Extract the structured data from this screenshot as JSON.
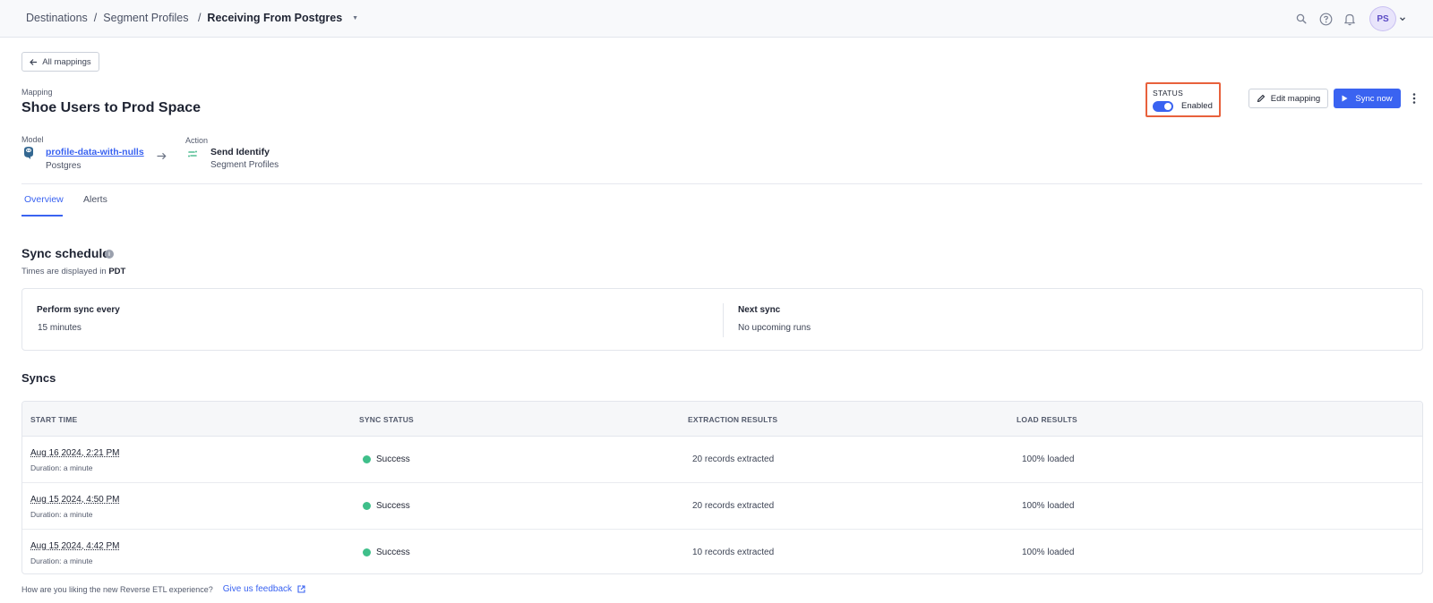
{
  "breadcrumbs": {
    "item1": "Destinations",
    "item2": "Segment Profiles",
    "current": "Receiving From Postgres"
  },
  "user": {
    "initials": "PS"
  },
  "back_button": "All mappings",
  "mapping": {
    "label": "Mapping",
    "title": "Shoe Users to Prod Space"
  },
  "status": {
    "label": "STATUS",
    "toggle_text": "Enabled",
    "enabled": true
  },
  "actions": {
    "edit": "Edit mapping",
    "sync": "Sync now"
  },
  "model": {
    "label": "Model",
    "name": "profile-data-with-nulls",
    "source": "Postgres"
  },
  "action": {
    "label": "Action",
    "name": "Send Identify",
    "destination": "Segment Profiles"
  },
  "tabs": {
    "overview": "Overview",
    "alerts": "Alerts"
  },
  "schedule": {
    "title": "Sync schedule",
    "tz_prefix": "Times are displayed in",
    "tz": "PDT",
    "perform_label": "Perform sync every",
    "perform_value": "15 minutes",
    "next_label": "Next sync",
    "next_value": "No upcoming runs"
  },
  "syncs": {
    "title": "Syncs",
    "columns": {
      "start": "START TIME",
      "status": "SYNC STATUS",
      "extraction": "EXTRACTION RESULTS",
      "load": "LOAD RESULTS"
    },
    "rows": [
      {
        "time": "Aug 16 2024, 2:21 PM",
        "duration": "Duration: a minute",
        "status": "Success",
        "extraction": "20  records extracted",
        "load": "100%  loaded"
      },
      {
        "time": "Aug 15 2024, 4:50 PM",
        "duration": "Duration: a minute",
        "status": "Success",
        "extraction": "20  records extracted",
        "load": "100%  loaded"
      },
      {
        "time": "Aug 15 2024, 4:42 PM",
        "duration": "Duration: a minute",
        "status": "Success",
        "extraction": "10  records extracted",
        "load": "100%  loaded"
      }
    ]
  },
  "feedback": {
    "question": "How are you liking the new Reverse ETL experience?",
    "link": "Give us feedback"
  },
  "colors": {
    "accent": "#3a63f1",
    "success": "#3fbf8a",
    "highlight": "#e8613c"
  }
}
